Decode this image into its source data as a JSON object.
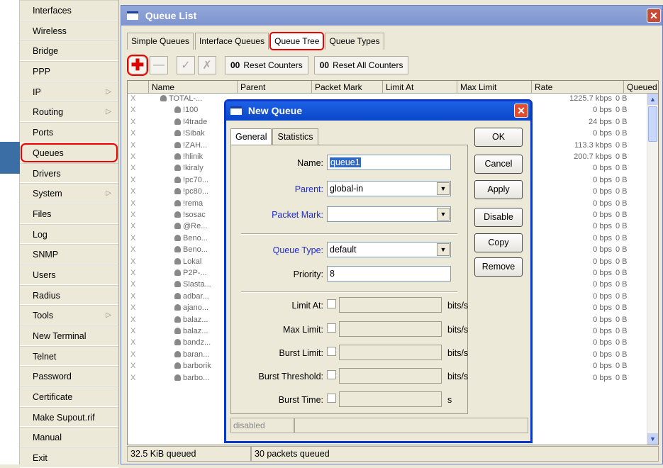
{
  "sidebar": {
    "items": [
      {
        "label": "Interfaces",
        "arrow": false
      },
      {
        "label": "Wireless",
        "arrow": false
      },
      {
        "label": "Bridge",
        "arrow": false
      },
      {
        "label": "PPP",
        "arrow": false
      },
      {
        "label": "IP",
        "arrow": true
      },
      {
        "label": "Routing",
        "arrow": true
      },
      {
        "label": "Ports",
        "arrow": false
      },
      {
        "label": "Queues",
        "arrow": false,
        "highlighted": true
      },
      {
        "label": "Drivers",
        "arrow": false
      },
      {
        "label": "System",
        "arrow": true
      },
      {
        "label": "Files",
        "arrow": false
      },
      {
        "label": "Log",
        "arrow": false
      },
      {
        "label": "SNMP",
        "arrow": false
      },
      {
        "label": "Users",
        "arrow": false
      },
      {
        "label": "Radius",
        "arrow": false
      },
      {
        "label": "Tools",
        "arrow": true
      },
      {
        "label": "New Terminal",
        "arrow": false
      },
      {
        "label": "Telnet",
        "arrow": false
      },
      {
        "label": "Password",
        "arrow": false
      },
      {
        "label": "Certificate",
        "arrow": false
      },
      {
        "label": "Make Supout.rif",
        "arrow": false
      },
      {
        "label": "Manual",
        "arrow": false
      },
      {
        "label": "Exit",
        "arrow": false
      }
    ]
  },
  "window": {
    "title": "Queue List",
    "close": "✕",
    "tabs": [
      "Simple Queues",
      "Interface Queues",
      "Queue Tree",
      "Queue Types"
    ],
    "active_tab": "Queue Tree",
    "toolbar": {
      "add": "✚",
      "remove": "—",
      "enable": "✓",
      "disable": "✗",
      "reset_counters_icon": "00",
      "reset_counters": "Reset Counters",
      "reset_all_icon": "00",
      "reset_all": "Reset All Counters"
    },
    "columns": [
      "Name",
      "Parent",
      "Packet Mark",
      "Limit At",
      "Max Limit",
      "Rate",
      "Queued"
    ],
    "rows": [
      {
        "x": "X",
        "name": "TOTAL-...",
        "rate": "1225.7 kbps",
        "queued": "0 B",
        "top": true
      },
      {
        "x": "X",
        "name": "!100",
        "rate": "0 bps",
        "queued": "0 B"
      },
      {
        "x": "X",
        "name": "!4trade",
        "rate": "24 bps",
        "queued": "0 B"
      },
      {
        "x": "X",
        "name": "!Sibak",
        "rate": "0 bps",
        "queued": "0 B"
      },
      {
        "x": "X",
        "name": "!ZAH...",
        "rate": "113.3 kbps",
        "queued": "0 B"
      },
      {
        "x": "X",
        "name": "!hlinik",
        "rate": "200.7 kbps",
        "queued": "0 B"
      },
      {
        "x": "X",
        "name": "!kiraly",
        "rate": "0 bps",
        "queued": "0 B"
      },
      {
        "x": "X",
        "name": "!pc70...",
        "rate": "0 bps",
        "queued": "0 B"
      },
      {
        "x": "X",
        "name": "!pc80...",
        "rate": "0 bps",
        "queued": "0 B"
      },
      {
        "x": "X",
        "name": "!rema",
        "rate": "0 bps",
        "queued": "0 B"
      },
      {
        "x": "X",
        "name": "!sosac",
        "rate": "0 bps",
        "queued": "0 B"
      },
      {
        "x": "X",
        "name": "@Re...",
        "rate": "0 bps",
        "queued": "0 B"
      },
      {
        "x": "X",
        "name": "Beno...",
        "rate": "0 bps",
        "queued": "0 B"
      },
      {
        "x": "X",
        "name": "Beno...",
        "rate": "0 bps",
        "queued": "0 B"
      },
      {
        "x": "X",
        "name": "Lokal",
        "rate": "0 bps",
        "queued": "0 B"
      },
      {
        "x": "X",
        "name": "P2P-...",
        "rate": "0 bps",
        "queued": "0 B"
      },
      {
        "x": "X",
        "name": "Slasta...",
        "rate": "0 bps",
        "queued": "0 B"
      },
      {
        "x": "X",
        "name": "adbar...",
        "rate": "0 bps",
        "queued": "0 B"
      },
      {
        "x": "X",
        "name": "ajano...",
        "rate": "0 bps",
        "queued": "0 B"
      },
      {
        "x": "X",
        "name": "balaz...",
        "rate": "0 bps",
        "queued": "0 B"
      },
      {
        "x": "X",
        "name": "balaz...",
        "rate": "0 bps",
        "queued": "0 B"
      },
      {
        "x": "X",
        "name": "bandz...",
        "rate": "0 bps",
        "queued": "0 B"
      },
      {
        "x": "X",
        "name": "baran...",
        "rate": "0 bps",
        "queued": "0 B"
      },
      {
        "x": "X",
        "name": "barborik",
        "rate": "0 bps",
        "queued": "0 B"
      },
      {
        "x": "X",
        "name": "barbo...",
        "rate": "0 bps",
        "queued": "0 B"
      }
    ],
    "status_left": "32.5 KiB queued",
    "status_right": "30 packets queued"
  },
  "dialog": {
    "title": "New Queue",
    "close": "✕",
    "tabs": [
      "General",
      "Statistics"
    ],
    "active_tab": "General",
    "fields": {
      "name_label": "Name:",
      "name_value": "queue1",
      "parent_label": "Parent:",
      "parent_value": "global-in",
      "packet_mark_label": "Packet Mark:",
      "packet_mark_value": "",
      "queue_type_label": "Queue Type:",
      "queue_type_value": "default",
      "priority_label": "Priority:",
      "priority_value": "8",
      "limit_at_label": "Limit At:",
      "max_limit_label": "Max Limit:",
      "burst_limit_label": "Burst Limit:",
      "burst_threshold_label": "Burst Threshold:",
      "burst_time_label": "Burst Time:",
      "unit_bits": "bits/s",
      "unit_s": "s"
    },
    "buttons": [
      "OK",
      "Cancel",
      "Apply",
      "Disable",
      "Copy",
      "Remove"
    ],
    "status": "disabled",
    "dropdown_glyph": "▼"
  },
  "colors": {
    "highlight": "#e00000",
    "dialog_title": "#0a46c9",
    "window_title": "#7d94cf",
    "blue_label": "#1f2bd0"
  },
  "icons": {
    "scroll_up": "▲",
    "scroll_down": "▼",
    "submenu": "▷"
  }
}
